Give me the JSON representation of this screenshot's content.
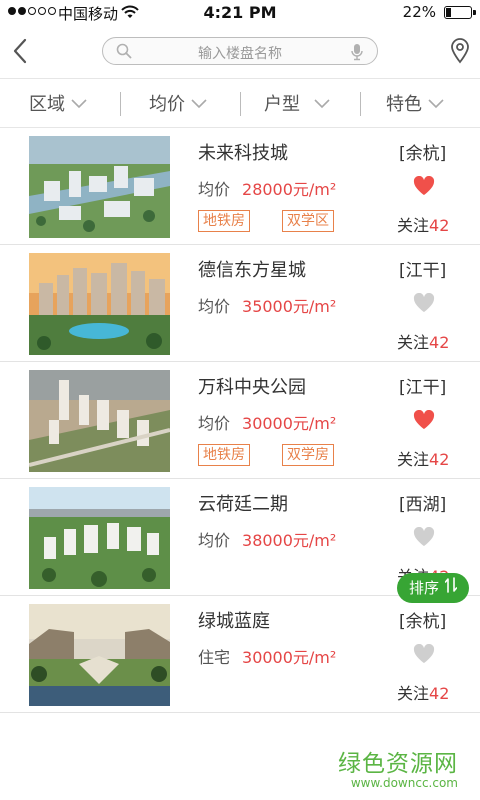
{
  "status_bar": {
    "carrier": "中国移动",
    "time": "4:21 PM",
    "battery": "22%",
    "battery_level": 0.22
  },
  "nav": {
    "search_placeholder": "输入楼盘名称"
  },
  "filters": [
    {
      "label": "区域"
    },
    {
      "label": "均价"
    },
    {
      "label": "户型"
    },
    {
      "label": "特色"
    }
  ],
  "follow_label": "关注",
  "listings": [
    {
      "name": "未来科技城",
      "district": "[余杭]",
      "price_label": "均价",
      "price": "28000元/m²",
      "tags": [
        "地铁房",
        "双学区"
      ],
      "liked": true,
      "follow_count": "42",
      "heart_color": "#f0504a"
    },
    {
      "name": "德信东方星城",
      "district": "[江干]",
      "price_label": "均价",
      "price": "35000元/m²",
      "tags": [],
      "liked": false,
      "follow_count": "42",
      "heart_color": "#cfcfcf"
    },
    {
      "name": "万科中央公园",
      "district": "[江干]",
      "price_label": "均价",
      "price": "30000元/m²",
      "tags": [
        "地铁房",
        "双学房"
      ],
      "liked": true,
      "follow_count": "42",
      "heart_color": "#f0504a"
    },
    {
      "name": "云荷廷二期",
      "district": "[西湖]",
      "price_label": "均价",
      "price": "38000元/m²",
      "tags": [],
      "liked": false,
      "follow_count": "42",
      "heart_color": "#cfcfcf"
    },
    {
      "name": "绿城蓝庭",
      "district": "[余杭]",
      "price_label": "住宅",
      "price": "30000元/m²",
      "tags": [],
      "liked": false,
      "follow_count": "42",
      "heart_color": "#cfcfcf"
    }
  ],
  "sort_button": {
    "label": "排序"
  },
  "watermark": {
    "cn": "绿色资源网",
    "en": "www.downcc.com"
  },
  "colors": {
    "accent_red": "#e54646",
    "tag_orange": "#e8814a",
    "sort_green": "#37a534",
    "watermark_green": "#5bb544"
  }
}
